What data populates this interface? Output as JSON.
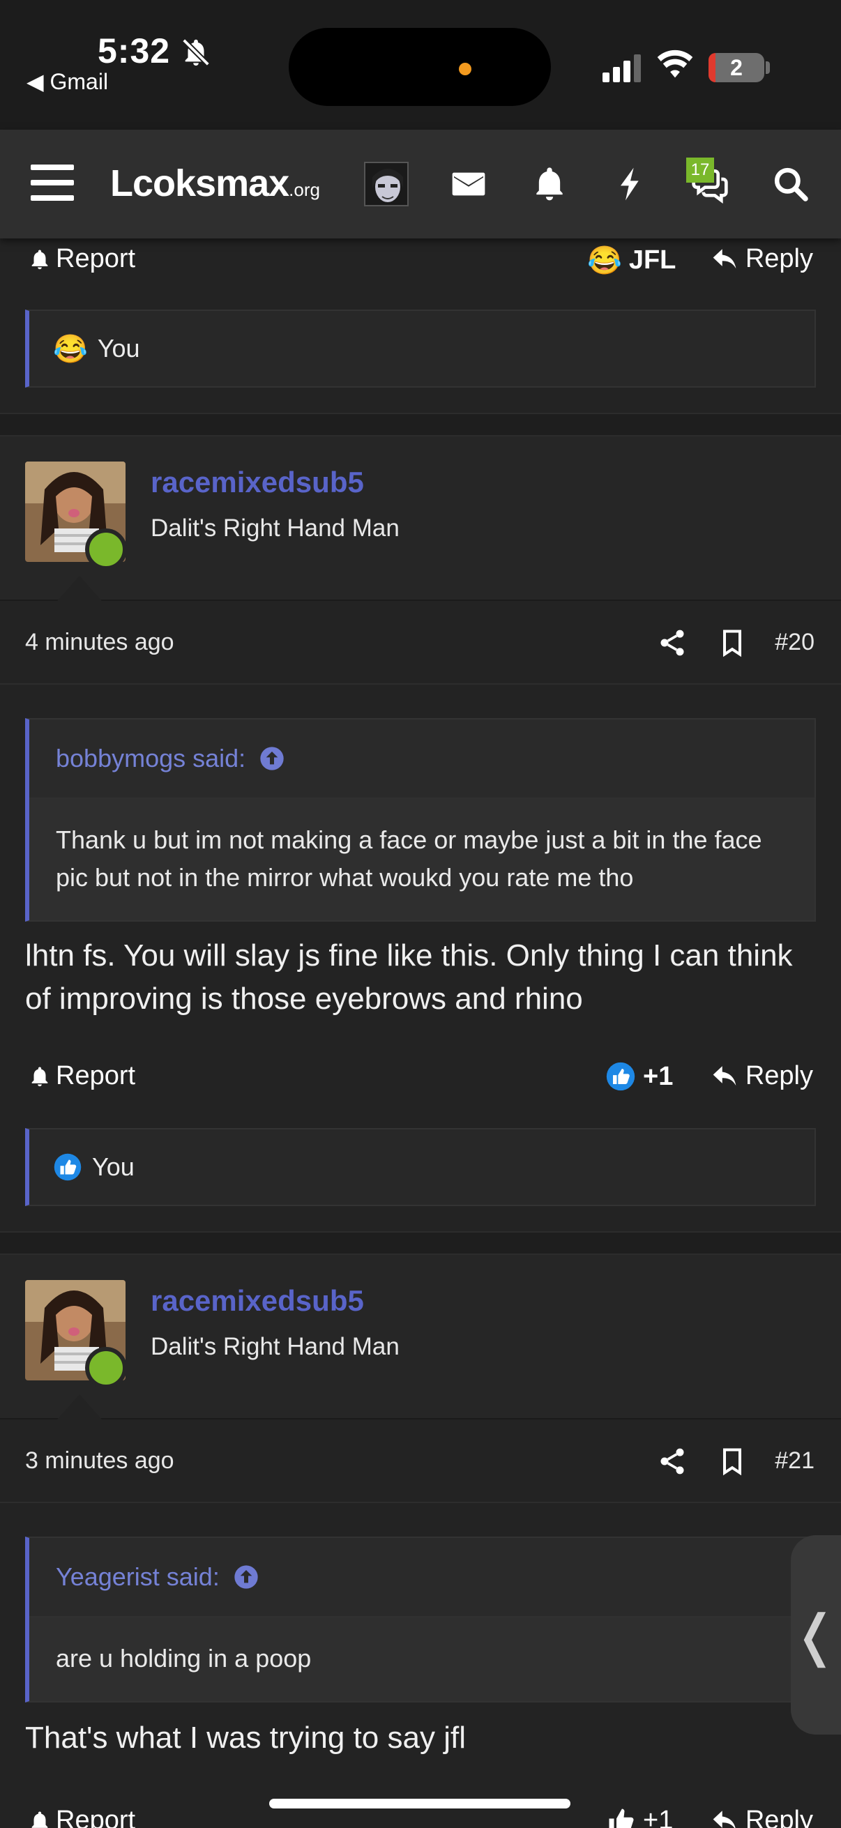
{
  "status_bar": {
    "time": "5:32",
    "back_app": "◀ Gmail",
    "battery": "2"
  },
  "nav": {
    "logo_main": "Lcoksmax",
    "logo_suffix": ".org",
    "chat_badge": "17"
  },
  "top_post": {
    "report_label": "Report",
    "reaction_label": "JFL",
    "reply_label": "Reply",
    "reaction_user": "You"
  },
  "posts": [
    {
      "username": "racemixedsub5",
      "user_title": "Dalit's Right Hand Man",
      "time_ago": "4 minutes ago",
      "post_number": "#20",
      "quote_author": "bobbymogs said:",
      "quote_text": "Thank u but im not making a face or maybe just a bit in the face pic but not in the mirror what woukd you rate me tho",
      "message": "lhtn fs. You will slay js fine like this. Only thing I can think of improving is those eyebrows and rhino",
      "report_label": "Report",
      "reaction_label": "+1",
      "reply_label": "Reply",
      "reaction_user": "You"
    },
    {
      "username": "racemixedsub5",
      "user_title": "Dalit's Right Hand Man",
      "time_ago": "3 minutes ago",
      "post_number": "#21",
      "quote_author": "Yeagerist said:",
      "quote_text": "are u holding in a poop",
      "message": "That's what I was trying to say jfl",
      "report_label": "Report",
      "reaction_label": "+1",
      "reply_label": "Reply"
    }
  ],
  "side_tab_glyph": "❬",
  "colors": {
    "accent": "#5964c9",
    "online": "#7ab82b",
    "background": "#232323"
  }
}
